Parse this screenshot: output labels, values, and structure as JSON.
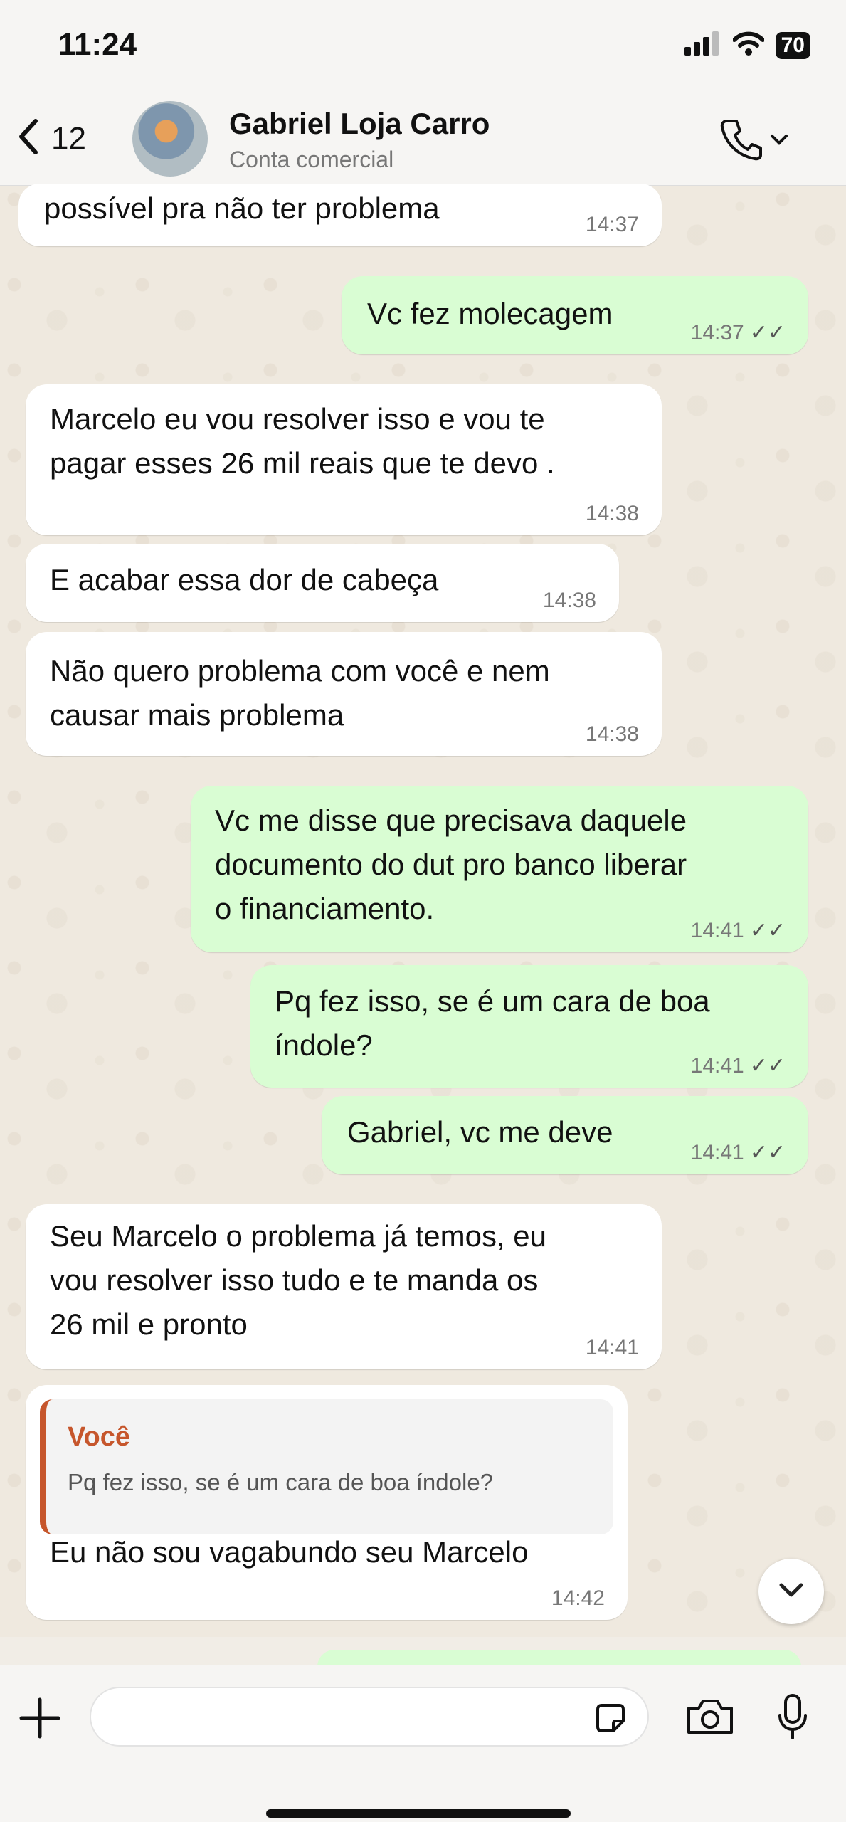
{
  "status_bar": {
    "time": "11:24",
    "battery": "70"
  },
  "header": {
    "back_count": "12",
    "contact_name": "Gabriel Loja Carro",
    "contact_subtitle": "Conta comercial"
  },
  "messages": [
    {
      "dir": "in",
      "text": "possível pra não ter problema",
      "time": "14:37"
    },
    {
      "dir": "out",
      "text": "Vc fez molecagem",
      "time": "14:37",
      "ticks": "✓✓"
    },
    {
      "dir": "in",
      "text": "Marcelo eu vou resolver isso e vou te\npagar esses 26 mil reais que te devo .",
      "time": "14:38"
    },
    {
      "dir": "in",
      "text": "E acabar essa dor de cabeça",
      "time": "14:38"
    },
    {
      "dir": "in",
      "text": "Não quero problema com você e nem\ncausar mais problema",
      "time": "14:38"
    },
    {
      "dir": "out",
      "text": "Vc me disse que precisava daquele\ndocumento do dut pro banco liberar\no financiamento.",
      "time": "14:41",
      "ticks": "✓✓"
    },
    {
      "dir": "out",
      "text": "Pq fez isso, se é um cara de boa\níndole?",
      "time": "14:41",
      "ticks": "✓✓"
    },
    {
      "dir": "out",
      "text": "Gabriel, vc me deve",
      "time": "14:41",
      "ticks": "✓✓"
    },
    {
      "dir": "in",
      "text": "Seu Marcelo o problema já temos, eu\nvou resolver isso tudo e te manda os\n26 mil e pronto",
      "time": "14:41"
    },
    {
      "dir": "in",
      "text": "Eu não sou vagabundo seu Marcelo",
      "time": "14:42",
      "quote_author": "Você",
      "quote_text": "Pq fez isso, se é um cara de boa índole?"
    }
  ]
}
